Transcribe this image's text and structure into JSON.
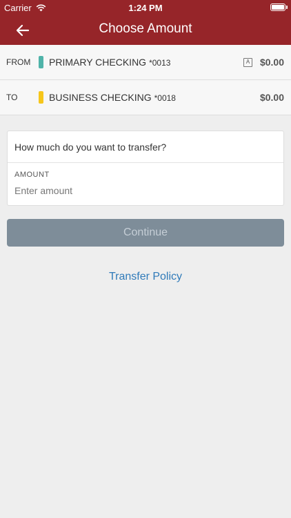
{
  "status_bar": {
    "carrier": "Carrier",
    "time": "1:24 PM",
    "wifi_icon": "wifi-icon",
    "battery_icon": "battery-icon"
  },
  "nav": {
    "title": "Choose Amount",
    "back_icon": "back-arrow-icon",
    "background_color": "#962529"
  },
  "accounts": {
    "from": {
      "direction": "FROM",
      "name": "PRIMARY CHECKING",
      "number": "*0013",
      "badge": "A",
      "balance": "$0.00",
      "color": "#4fb3a9"
    },
    "to": {
      "direction": "TO",
      "name": "BUSINESS CHECKING",
      "number": "*0018",
      "balance": "$0.00",
      "color": "#f6c61b"
    }
  },
  "form": {
    "question": "How much do you want to transfer?",
    "amount_label": "AMOUNT",
    "amount_placeholder": "Enter amount",
    "amount_value": ""
  },
  "actions": {
    "continue_label": "Continue",
    "continue_color": "#7e8d99",
    "policy_label": "Transfer Policy",
    "policy_color": "#2f7ab9"
  }
}
